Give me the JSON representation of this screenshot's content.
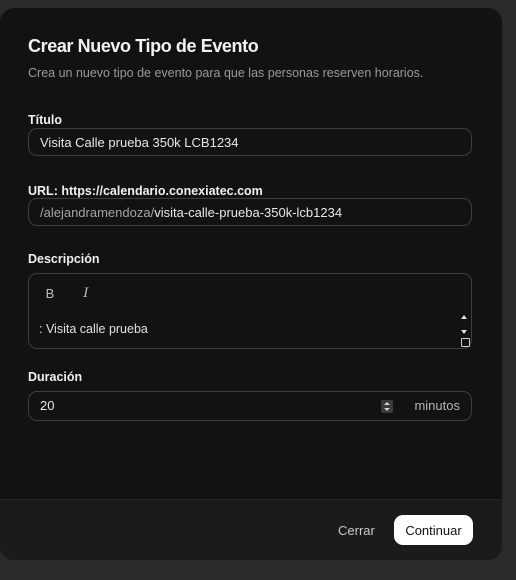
{
  "dialog": {
    "title": "Crear Nuevo Tipo de Evento",
    "subtitle": "Crea un nuevo tipo de evento para que las personas reserven horarios."
  },
  "form": {
    "title_label": "Título",
    "title_value": "Visita Calle prueba 350k LCB1234",
    "url_label": "URL: https://calendario.conexiatec.com",
    "url_prefix": "/alejandramendoza/",
    "url_slug": "visita-calle-prueba-350k-lcb1234",
    "description_label": "Descripción",
    "description_bold": "B",
    "description_italic": "I",
    "description_value": ": Visita calle prueba",
    "duration_label": "Duración",
    "duration_value": "20",
    "duration_unit": "minutos"
  },
  "footer": {
    "cancel_label": "Cerrar",
    "continue_label": "Continuar"
  },
  "icons": {
    "bold": "bold-icon",
    "italic": "italic-icon",
    "spinner": "number-spinner-icon",
    "resize": "resize-handle-icon"
  }
}
